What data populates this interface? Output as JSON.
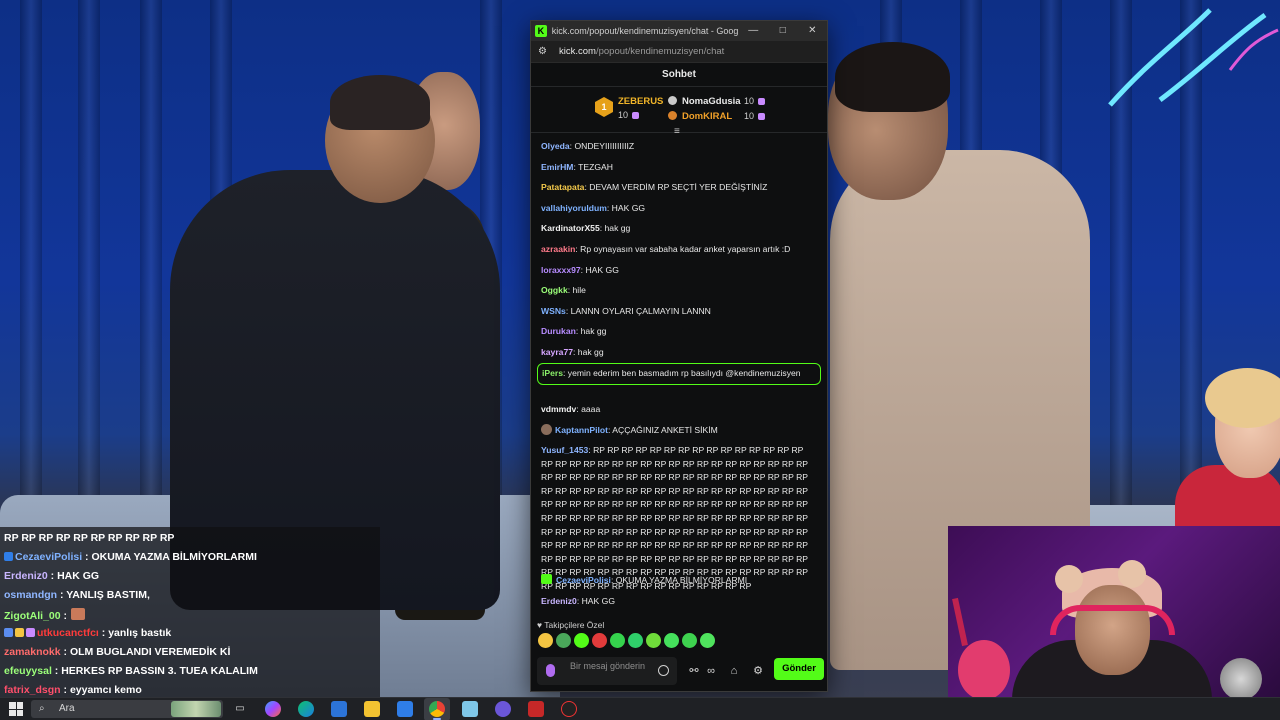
{
  "browser": {
    "title": "kick.com/popout/kendinemuzisyen/chat - Google C...",
    "url_host": "kick.com",
    "url_path": "/popout/kendinemuzisyen/chat",
    "favicon_letter": "K",
    "min_glyph": "—",
    "max_glyph": "□",
    "close_glyph": "✕"
  },
  "chat": {
    "header": "Sohbet",
    "leaders": {
      "first": {
        "rank": "1",
        "name": "ZEBERUS",
        "count": "10"
      },
      "second": {
        "name": "NomaGdusia",
        "count": "10"
      },
      "third": {
        "name": "DomKIRAL",
        "count": "10"
      }
    },
    "messages": [
      {
        "user": "Olyeda",
        "color": "#8fb6ff",
        "text": ": ONDEYIIIIIIIIIIZ"
      },
      {
        "user": "EmirHM",
        "color": "#8fb6ff",
        "text": ": TEZGAH"
      },
      {
        "user": "Patatapata",
        "color": "#f3c94b",
        "text": ": DEVAM VERDİM RP SEÇTİ YER DEĞİŞTİNİZ"
      },
      {
        "user": "vallahiyoruldum",
        "color": "#7fb2ff",
        "text": ": HAK GG"
      },
      {
        "user": "KardinatorX55",
        "color": "#f1f1f1",
        "text": ": hak gg"
      },
      {
        "user": "azraakin",
        "color": "#ff7a8a",
        "text": ": Rp oynayasın var sabaha kadar anket yaparsın artık :D"
      },
      {
        "user": "loraxxx97",
        "color": "#b78cff",
        "text": ": HAK GG"
      },
      {
        "user": "Oggkk",
        "color": "#9cff7a",
        "text": ": hile"
      },
      {
        "user": "WSNs",
        "color": "#7fb2ff",
        "text": ": LANNN OYLARI ÇALMAYIN LANNN"
      },
      {
        "user": "Durukan",
        "color": "#b78cff",
        "text": ": hak gg"
      },
      {
        "user": "kayra77",
        "color": "#d6a6ff",
        "text": ": hak gg"
      }
    ],
    "mention": {
      "user": "iPers",
      "color": "#8cf16a",
      "text": ": yemin ederim ben basmadım rp basılıydı @kendinemuzisyen"
    },
    "messages_after": [
      {
        "user": "vdmmdv",
        "color": "#f1f1f1",
        "text": ": aaaa"
      },
      {
        "user": "KaptannPilot",
        "color": "#7fb2ff",
        "text": ": AÇÇAĞINIZ ANKETİ SİKİM"
      }
    ],
    "spam": {
      "user": "Yusuf_1453",
      "color": "#8fb6ff",
      "text": ": RP RP RP RP RP RP RP RP RP RP RP RP RP RP RP RP RP RP RP RP RP RP RP RP RP RP RP RP RP RP RP RP RP RP RP RP RP RP RP RP RP RP RP RP RP RP RP RP RP RP RP RP RP RP RP RP RP RP RP RP RP RP RP RP RP RP RP RP RP RP RP RP RP RP RP RP RP RP RP RP RP RP RP RP RP RP RP RP RP RP RP RP RP RP RP RP RP RP RP RP RP RP RP RP RP RP RP RP RP RP RP RP RP RP RP RP RP RP RP RP RP RP RP RP RP RP RP RP RP RP RP RP RP RP RP RP RP RP RP RP RP RP RP RP RP RP RP RP RP RP RP RP RP RP RP RP RP RP RP RP RP RP RP RP RP RP RP RP RP RP RP RP RP RP RP RP RP RP RP RP RP RP RP RP RP RP RP RP RP RP RP RP RP RP RP RP RP RP RP RP RP"
    },
    "messages_tail": [
      {
        "user": "CezaeviPolisi",
        "color": "#7fb2ff",
        "text": ": OKUMA YAZMA BİLMİYORLARMI"
      },
      {
        "user": "Erdeniz0",
        "color": "#c9b6ff",
        "text": ": HAK GG"
      }
    ],
    "subscriber_label": "Takipçilere Özel",
    "composer_placeholder": "Bir mesaj gönderin",
    "send_label": "Gönder"
  },
  "overlay": {
    "lines": [
      {
        "user": "",
        "text": "RP RP RP RP RP RP RP RP RP RP",
        "color": "#ffffff"
      },
      {
        "user": "CezaeviPolisi",
        "text": " : OKUMA YAZMA BİLMİYORLARMI",
        "color": "#7fb2ff"
      },
      {
        "user": "Erdeniz0",
        "text": " : HAK GG",
        "color": "#c9b6ff"
      },
      {
        "user": "osmandgn",
        "text": " : YANLIŞ BASTIM,",
        "color": "#8fb6ff"
      },
      {
        "user": "ZigotAli_00",
        "text": " :",
        "color": "#9cff7a"
      },
      {
        "user": "utkucanctfcı",
        "text": " : yanlış bastık",
        "color": "#ff3b3b"
      },
      {
        "user": "zamaknokk",
        "text": " : OLM BUGLANDI VEREMEDİK Kİ",
        "color": "#ff6b6b"
      },
      {
        "user": "efeuyysal",
        "text": " : HERKES RP BASSIN 3. TUEA KALALIM",
        "color": "#9cff7a"
      },
      {
        "user": "fatrix_dsgn",
        "text": " : eyyamcı kemo",
        "color": "#ff4f6b"
      }
    ]
  },
  "taskbar": {
    "search_placeholder": "Ara"
  }
}
